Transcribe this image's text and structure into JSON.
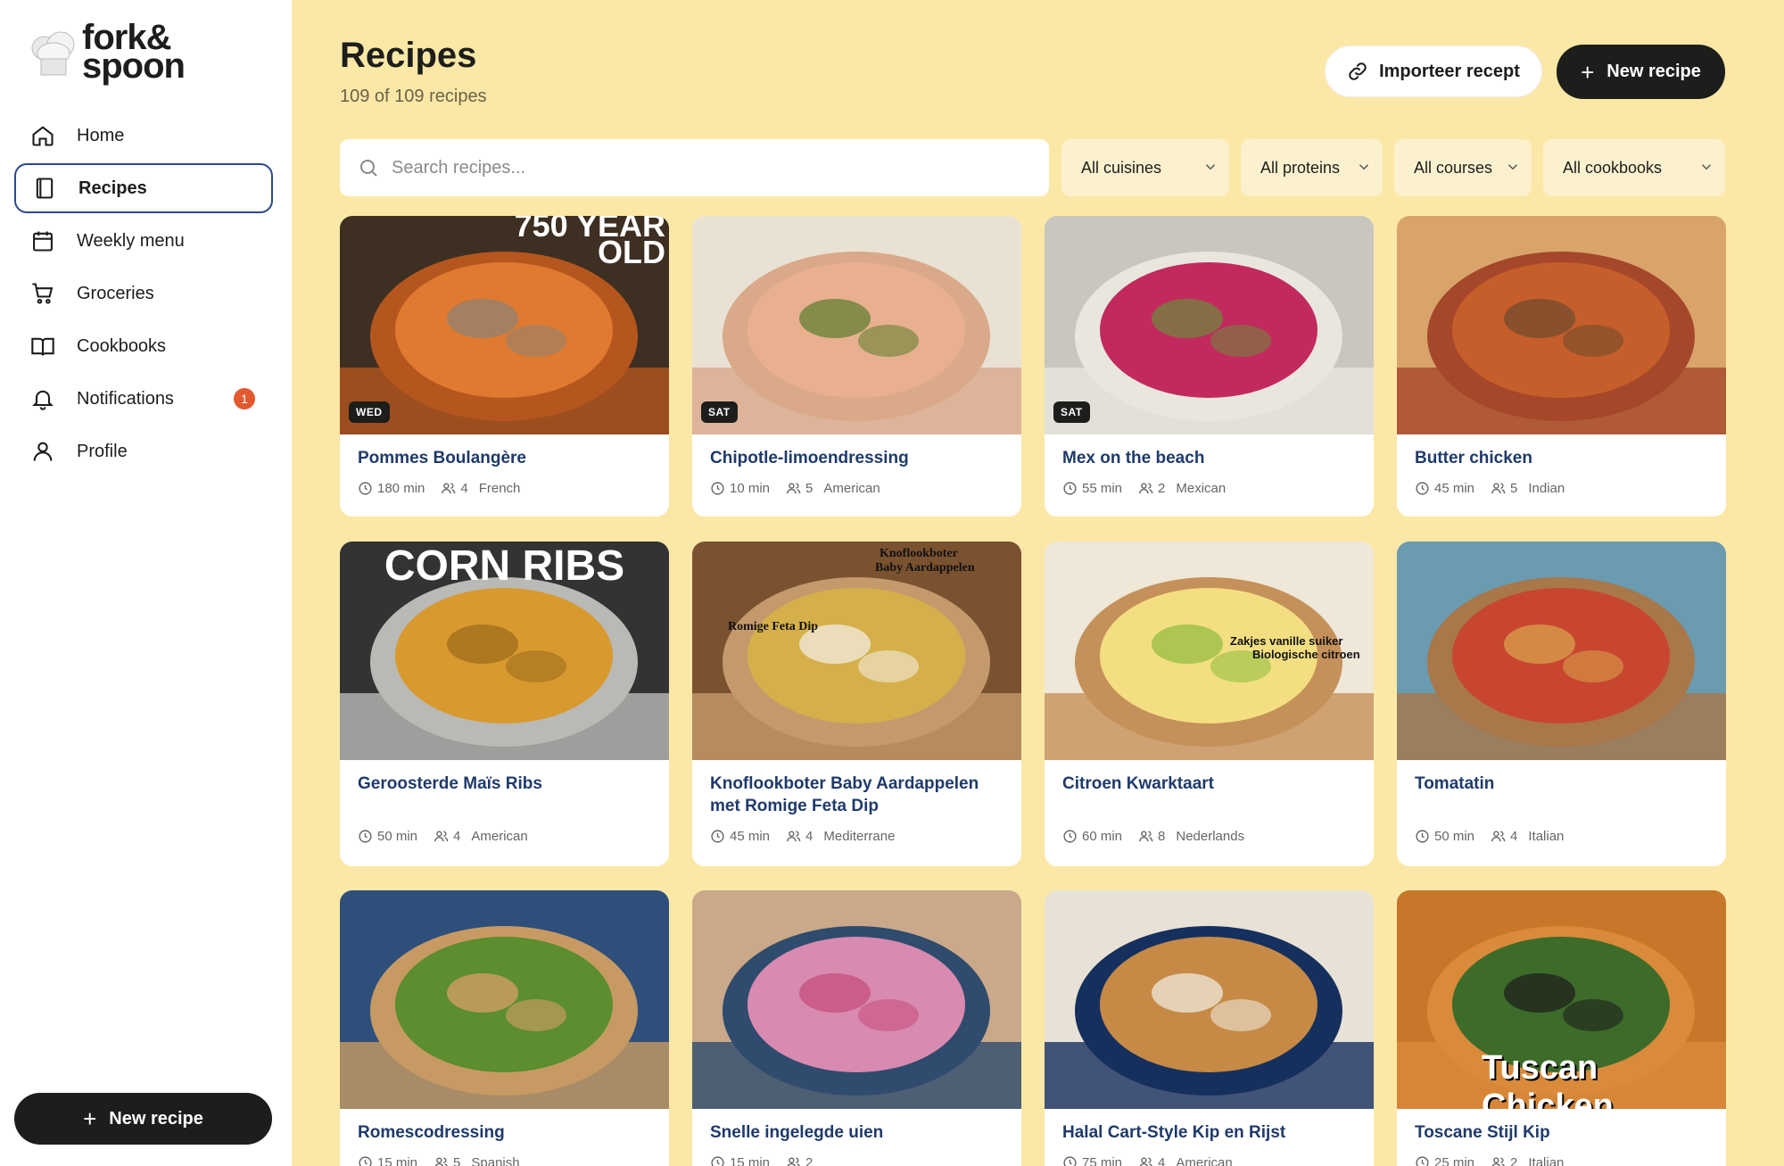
{
  "app": {
    "logo_line1": "fork&",
    "logo_line2": "spoon"
  },
  "sidebar": {
    "items": [
      {
        "label": "Home",
        "icon": "home-icon"
      },
      {
        "label": "Recipes",
        "icon": "book-icon",
        "active": true
      },
      {
        "label": "Weekly menu",
        "icon": "calendar-icon"
      },
      {
        "label": "Groceries",
        "icon": "cart-icon"
      },
      {
        "label": "Cookbooks",
        "icon": "open-book-icon"
      },
      {
        "label": "Notifications",
        "icon": "bell-icon",
        "badge": "1"
      },
      {
        "label": "Profile",
        "icon": "user-icon"
      }
    ],
    "new_recipe_label": "New recipe"
  },
  "header": {
    "title": "Recipes",
    "subtitle": "109 of 109 recipes",
    "import_label": "Importeer recept",
    "new_recipe_label": "New recipe"
  },
  "filters": {
    "search_placeholder": "Search recipes...",
    "cuisine": "All cuisines",
    "protein": "All proteins",
    "course": "All courses",
    "cookbook": "All cookbooks"
  },
  "colors": {
    "background": "#fbe8a6",
    "accent_dark": "#1d1d1b",
    "title_blue": "#1f3a6b",
    "badge": "#e2582f",
    "active_border": "#2c4a8a"
  },
  "recipes": [
    {
      "title": "Pommes Boulangère",
      "time": "180 min",
      "servings": "4",
      "cuisine": "French",
      "day": "WED",
      "overlay": "750 YEAR\nOLD"
    },
    {
      "title": "Chipotle-limoendressing",
      "time": "10 min",
      "servings": "5",
      "cuisine": "American",
      "day": "SAT"
    },
    {
      "title": "Mex on the beach",
      "time": "55 min",
      "servings": "2",
      "cuisine": "Mexican",
      "day": "SAT"
    },
    {
      "title": "Butter chicken",
      "time": "45 min",
      "servings": "5",
      "cuisine": "Indian"
    },
    {
      "title": "Geroosterde Maïs Ribs",
      "time": "50 min",
      "servings": "4",
      "cuisine": "American",
      "overlay": "CORN RIBS"
    },
    {
      "title": "Knoflookboter Baby Aardappelen met Romige Feta Dip",
      "time": "45 min",
      "servings": "4",
      "cuisine": "Mediterrane",
      "overlay_a": "Knoflookboter",
      "overlay_b": "Baby Aardappelen",
      "overlay_c": "Romige Feta Dip"
    },
    {
      "title": "Citroen Kwarktaart",
      "time": "60 min",
      "servings": "8",
      "cuisine": "Nederlands",
      "overlay_a": "Zakjes vanille suiker",
      "overlay_b": "Biologische citroen"
    },
    {
      "title": "Tomatatin",
      "time": "50 min",
      "servings": "4",
      "cuisine": "Italian"
    },
    {
      "title": "Romescodressing",
      "time": "15 min",
      "servings": "5",
      "cuisine": "Spanish"
    },
    {
      "title": "Snelle ingelegde uien",
      "time": "15 min",
      "servings": "2",
      "cuisine": ""
    },
    {
      "title": "Halal Cart-Style Kip en Rijst",
      "time": "75 min",
      "servings": "4",
      "cuisine": "American"
    },
    {
      "title": "Toscane Stijl Kip",
      "time": "25 min",
      "servings": "2",
      "cuisine": "Italian",
      "overlay": "Tuscan Chicken"
    }
  ]
}
